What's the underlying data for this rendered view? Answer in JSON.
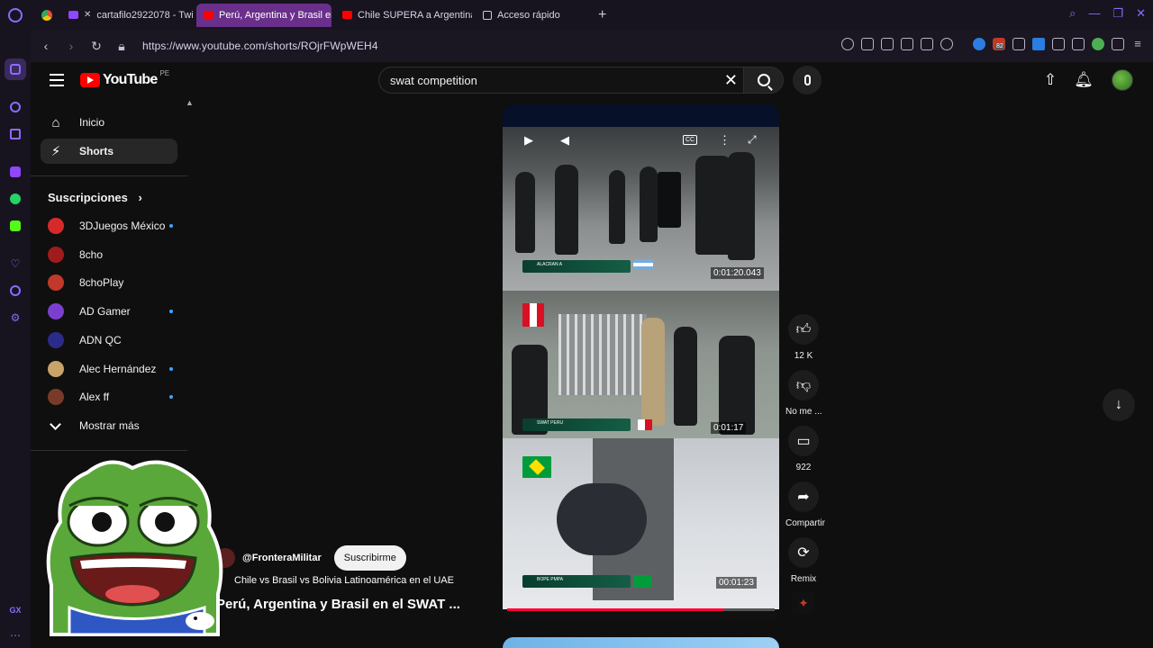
{
  "browser": {
    "tabs": [
      {
        "label": "cartafilo2922078 - Twi",
        "favicon": "twitch-icon",
        "muted": true,
        "active": false
      },
      {
        "label": "Perú, Argentina y Brasil en",
        "favicon": "youtube-icon",
        "active": true
      },
      {
        "label": "Chile SUPERA a Argentina",
        "favicon": "youtube-icon",
        "active": false
      },
      {
        "label": "Acceso rápido",
        "favicon": "grid-icon",
        "active": false
      }
    ],
    "new_tab": "+",
    "url": "https://www.youtube.com/shorts/ROjrFWpWEH4",
    "extension_badge": "82",
    "accent": "#8c6bff"
  },
  "opera_sidebar": {
    "bottom_label": "GX"
  },
  "youtube": {
    "logo_text": "YouTube",
    "country_code": "PE",
    "search": {
      "value": "swat competition"
    },
    "nav": [
      {
        "label": "Inicio",
        "icon": "home-icon"
      },
      {
        "label": "Shorts",
        "icon": "shorts-icon",
        "active": true
      }
    ],
    "subscriptions_title": "Suscripciones",
    "subscriptions": [
      {
        "name": "3DJuegos México",
        "color": "#d62a2a",
        "new": true
      },
      {
        "name": "8cho",
        "color": "#a01c1c",
        "new": false
      },
      {
        "name": "8choPlay",
        "color": "#c0392b",
        "new": false
      },
      {
        "name": "AD Gamer",
        "color": "#7b3fd0",
        "new": true
      },
      {
        "name": "ADN QC",
        "color": "#2b2b8a",
        "new": false
      },
      {
        "name": "Alec Hernández",
        "color": "#c8a36a",
        "new": true
      },
      {
        "name": "Alex ff",
        "color": "#7a3a2a",
        "new": true
      }
    ],
    "show_more": "Mostrar más",
    "short": {
      "panels": [
        {
          "timer": "0:01:20.043",
          "team": "ALACRAN A",
          "flag": "argentina"
        },
        {
          "timer": "0:01:17",
          "team": "SWAT PERU",
          "flag": "peru"
        },
        {
          "timer": "00:01:23",
          "team": "BOPE PMPA",
          "flag": "brazil"
        }
      ],
      "progress": 0.81,
      "channel": "@FronteraMilitar",
      "subscribe_label": "Suscribirme",
      "description": "Chile vs Brasil vs Bolivia Latinoamérica en el UAE",
      "title": "Perú, Argentina y Brasil en el SWAT ..."
    },
    "actions": [
      {
        "icon": "thumbs-up-icon",
        "label": "12 K"
      },
      {
        "icon": "thumbs-down-icon",
        "label": "No me ..."
      },
      {
        "icon": "comment-icon",
        "label": "922"
      },
      {
        "icon": "share-icon",
        "label": "Compartir"
      },
      {
        "icon": "remix-icon",
        "label": "Remix"
      }
    ]
  }
}
